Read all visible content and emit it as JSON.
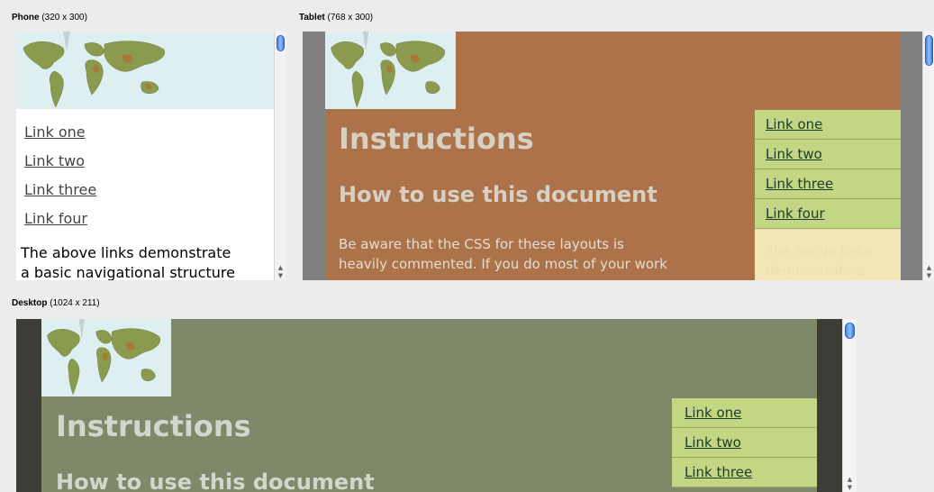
{
  "frames": {
    "phone": {
      "name": "Phone",
      "dims": "(320 x 300)"
    },
    "tablet": {
      "name": "Tablet",
      "dims": "(768 x 300)"
    },
    "desktop": {
      "name": "Desktop",
      "dims": "(1024 x 211)"
    }
  },
  "nav_links": [
    "Link one",
    "Link two",
    "Link three",
    "Link four"
  ],
  "phone_body": {
    "line1": "The above links demonstrate",
    "line2": "a basic navigational structure"
  },
  "tablet_body": {
    "line1": "Be aware that the CSS for these layouts is",
    "line2": "heavily commented. If you do most of your work"
  },
  "sidebar_text": {
    "line1": "The above links",
    "line2": "demonstrate a"
  },
  "page_heading": "Instructions",
  "sub_heading": "How to use this document",
  "colors": {
    "tablet_bg": "#ac734a",
    "desktop_bg": "#7d8968",
    "nav_green": "#c2d683",
    "map_bg": "#ddeff1",
    "scroll_thumb": "#5b93e8"
  },
  "icons": {
    "scroll_up": "scroll-up-arrow-icon",
    "scroll_down": "scroll-down-arrow-icon",
    "map": "world-map-icon"
  }
}
